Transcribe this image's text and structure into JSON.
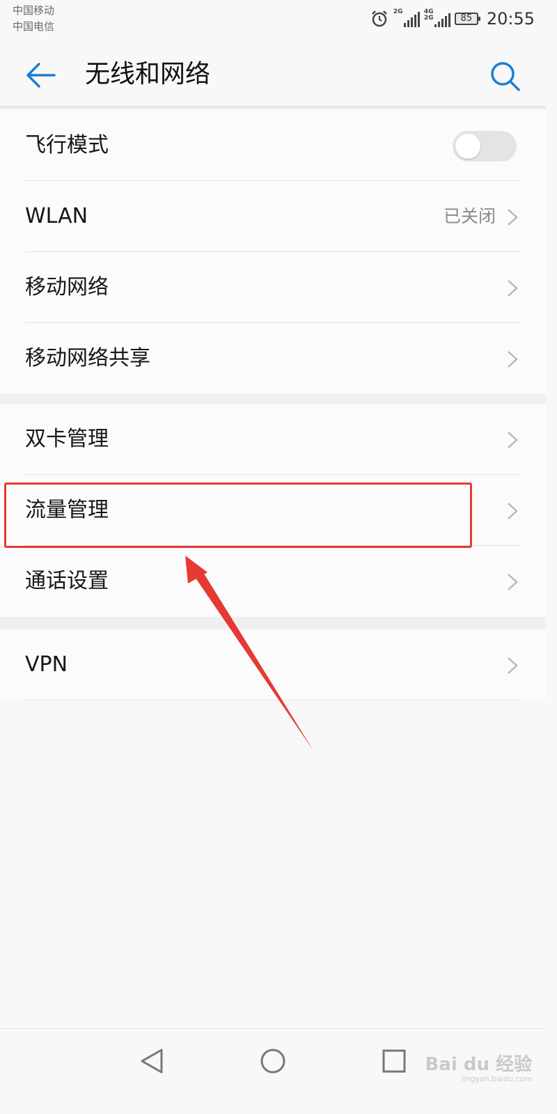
{
  "status_bar": {
    "carrier_1": "中国移动",
    "carrier_2": "中国电信",
    "sim1_tag": "2G",
    "sim2_tag": "4G 2G",
    "battery": "85",
    "time": "20:55"
  },
  "header": {
    "title": "无线和网络",
    "back_icon": "arrow-left-icon",
    "search_icon": "search-icon",
    "accent_color": "#1a7fd4"
  },
  "groups": [
    {
      "items": [
        {
          "label": "飞行模式",
          "type": "toggle",
          "on": false
        },
        {
          "label": "WLAN",
          "value": "已关闭",
          "type": "link"
        },
        {
          "label": "移动网络",
          "type": "link"
        },
        {
          "label": "移动网络共享",
          "type": "link"
        }
      ]
    },
    {
      "items": [
        {
          "label": "双卡管理",
          "type": "link"
        },
        {
          "label": "流量管理",
          "type": "link",
          "highlighted": true
        },
        {
          "label": "通话设置",
          "type": "link"
        }
      ]
    },
    {
      "items": [
        {
          "label": "VPN",
          "type": "link"
        }
      ]
    }
  ],
  "annotation": {
    "highlight_color": "#e53a33",
    "arrow_color": "#e53a33"
  },
  "nav_bar": {
    "back": "triangle-back-icon",
    "home": "circle-home-icon",
    "recents": "square-recents-icon"
  },
  "watermark": {
    "brand": "Bai du 经验",
    "url": "jingyan.baidu.com"
  }
}
